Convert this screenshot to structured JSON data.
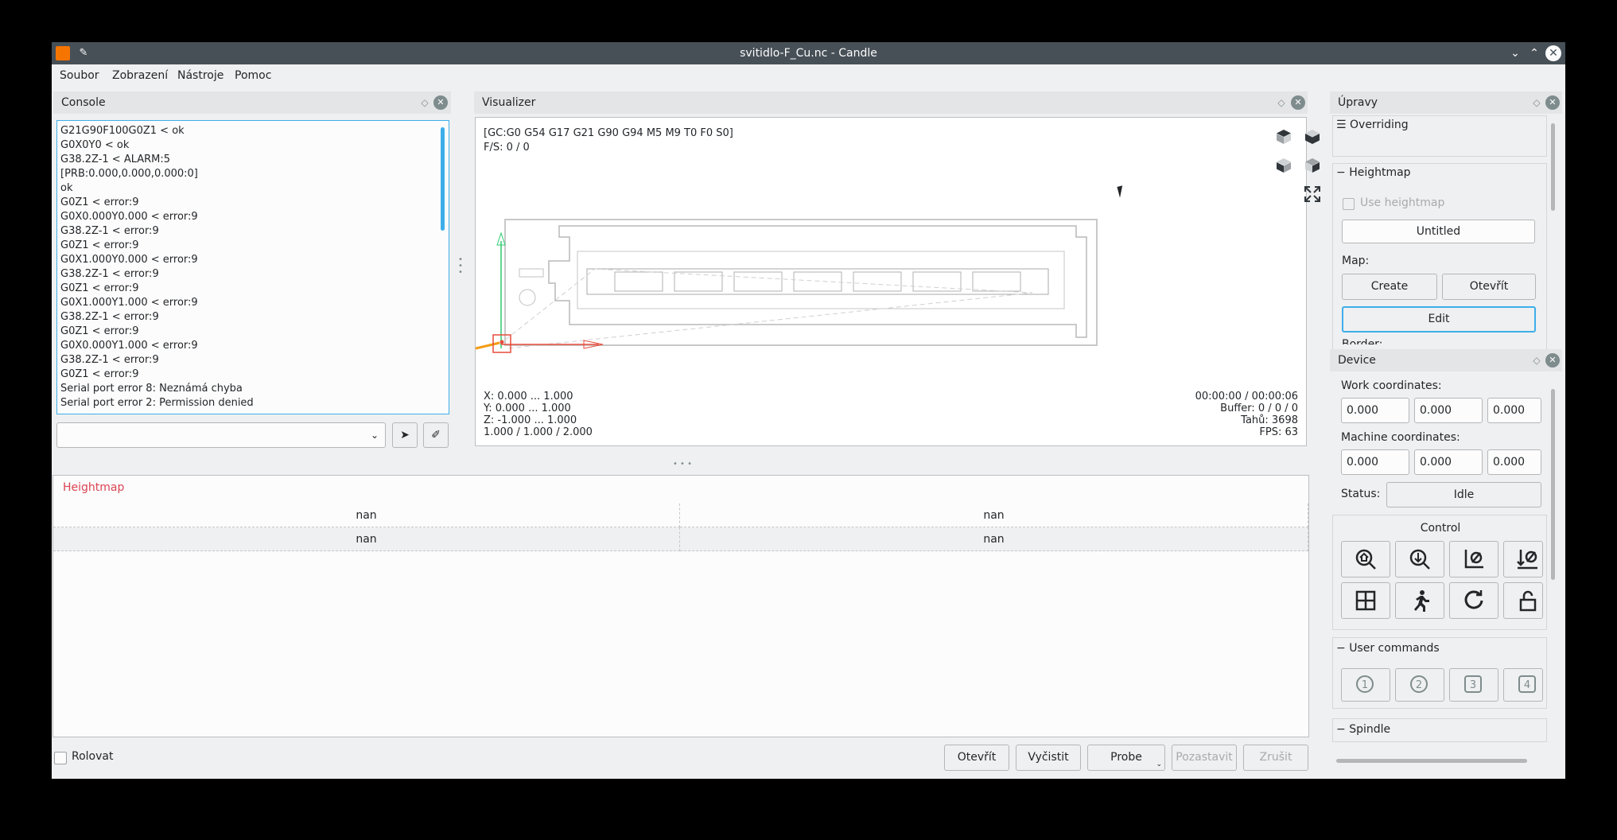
{
  "window": {
    "title": "svitidlo-F_Cu.nc - Candle"
  },
  "menu": [
    "Soubor",
    "Zobrazení",
    "Nástroje",
    "Pomoc"
  ],
  "console": {
    "title": "Console",
    "lines": [
      "G21G90F100G0Z1 < ok",
      "G0X0Y0 < ok",
      "G38.2Z-1 < ALARM:5",
      "[PRB:0.000,0.000,0.000:0]",
      "ok",
      "G0Z1 < error:9",
      "G0X0.000Y0.000 < error:9",
      "G38.2Z-1 < error:9",
      "G0Z1 < error:9",
      "G0X1.000Y0.000 < error:9",
      "G38.2Z-1 < error:9",
      "G0Z1 < error:9",
      "G0X1.000Y1.000 < error:9",
      "G38.2Z-1 < error:9",
      "G0Z1 < error:9",
      "G0X0.000Y1.000 < error:9",
      "G38.2Z-1 < error:9",
      "G0Z1 < error:9",
      "Serial port error 8: Neznámá chyba",
      "Serial port error 2: Permission denied"
    ],
    "input_value": ""
  },
  "visualizer": {
    "title": "Visualizer",
    "gc_state": "[GC:G0 G54 G17 G21 G90 G94 M5 M9 T0 F0 S0]",
    "fs": "F/S: 0 / 0",
    "x_range": "X: 0.000 ... 1.000",
    "y_range": "Y: 0.000 ... 1.000",
    "z_range": "Z: -1.000 ... 1.000",
    "size": "1.000 / 1.000 / 2.000",
    "time": "00:00:00 / 00:00:06",
    "buffer": "Buffer: 0 / 0 / 0",
    "tahu": "Tahů: 3698",
    "fps": "FPS: 63"
  },
  "heightmap_table": {
    "title": "Heightmap",
    "rows": [
      [
        "nan",
        "nan"
      ],
      [
        "nan",
        "nan"
      ]
    ]
  },
  "bottom_bar": {
    "rolovat": "Rolovat",
    "buttons": [
      "Otevřít",
      "Vyčistit",
      "Probe",
      "Pozastavit",
      "Zrušit"
    ]
  },
  "upravy": {
    "title": "Úpravy",
    "overriding": "Overriding",
    "heightmap": "Heightmap",
    "use_heightmap": "Use heightmap",
    "name": "Untitled",
    "map_label": "Map:",
    "create": "Create",
    "open": "Otevřít",
    "edit": "Edit",
    "border": "Border:"
  },
  "device": {
    "title": "Device",
    "work_label": "Work coordinates:",
    "work": [
      "0.000",
      "0.000",
      "0.000"
    ],
    "machine_label": "Machine coordinates:",
    "machine": [
      "0.000",
      "0.000",
      "0.000"
    ],
    "status_label": "Status:",
    "status": "Idle",
    "control": "Control",
    "user_commands": "User commands",
    "user_buttons": [
      "1",
      "2",
      "3",
      "4"
    ],
    "spindle": "Spindle"
  },
  "colors": {
    "accent": "#3daee9",
    "heightmap_title": "#da4453",
    "titlebar": "#475057"
  }
}
